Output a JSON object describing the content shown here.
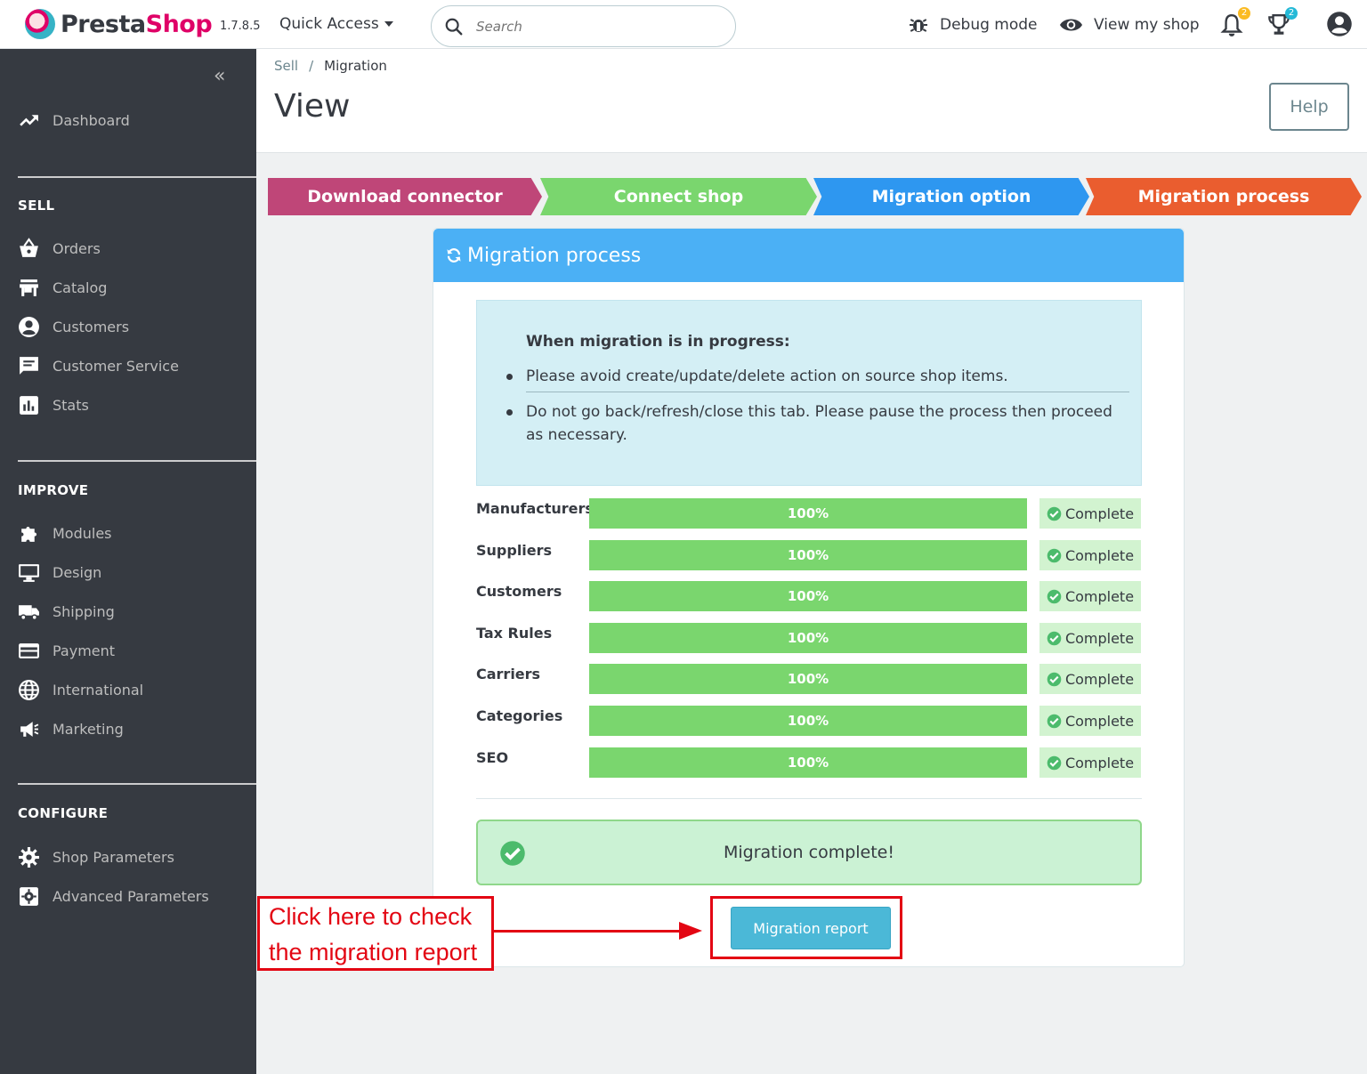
{
  "app": {
    "brand_presta": "Presta",
    "brand_shop": "Shop",
    "version": "1.7.8.5",
    "quick_access": "Quick Access",
    "search_placeholder": "Search",
    "debug_mode": "Debug mode",
    "view_shop": "View my shop",
    "notifications_count": "2",
    "trophy_count": "2"
  },
  "sidebar": {
    "collapse": "«",
    "dashboard": "Dashboard",
    "sections": {
      "sell": "SELL",
      "improve": "IMPROVE",
      "configure": "CONFIGURE"
    },
    "sell_items": [
      "Orders",
      "Catalog",
      "Customers",
      "Customer Service",
      "Stats"
    ],
    "improve_items": [
      "Modules",
      "Design",
      "Shipping",
      "Payment",
      "International",
      "Marketing"
    ],
    "configure_items": [
      "Shop Parameters",
      "Advanced Parameters"
    ]
  },
  "page": {
    "breadcrumb_parent": "Sell",
    "breadcrumb_sep": "/",
    "breadcrumb_current": "Migration",
    "title": "View",
    "help": "Help"
  },
  "steps": [
    {
      "label": "Download connector",
      "color": "#bf4678"
    },
    {
      "label": "Connect shop",
      "color": "#7ad66e"
    },
    {
      "label": "Migration option",
      "color": "#2e97f0"
    },
    {
      "label": "Migration process",
      "color": "#ea5d2f"
    }
  ],
  "panel": {
    "title": "Migration process",
    "info_title": "When migration is in progress:",
    "info_items": [
      "Please avoid create/update/delete action on source shop items.",
      "Do not go back/refresh/close this tab. Please pause the process then proceed as necessary."
    ],
    "progress": [
      {
        "label": "Manufacturers",
        "percent": "100%",
        "status": "Complete"
      },
      {
        "label": "Suppliers",
        "percent": "100%",
        "status": "Complete"
      },
      {
        "label": "Customers",
        "percent": "100%",
        "status": "Complete"
      },
      {
        "label": "Tax Rules",
        "percent": "100%",
        "status": "Complete"
      },
      {
        "label": "Carriers",
        "percent": "100%",
        "status": "Complete"
      },
      {
        "label": "Categories",
        "percent": "100%",
        "status": "Complete"
      },
      {
        "label": "SEO",
        "percent": "100%",
        "status": "Complete"
      }
    ],
    "success_message": "Migration complete!",
    "report_button": "Migration report"
  },
  "annotation": {
    "line1": "Click here to check",
    "line2": "the migration report",
    "color": "#e30613"
  }
}
